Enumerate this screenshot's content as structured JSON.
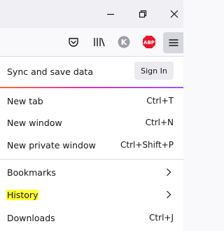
{
  "toolbar": {
    "icons": [
      "pocket-icon",
      "library-icon",
      "k-extension-icon",
      "adblock-plus-icon",
      "hamburger-menu-icon"
    ],
    "k_label": "K",
    "abp_label": "ABP"
  },
  "menu": {
    "sync_label": "Sync and save data",
    "signin_label": "Sign In",
    "items": [
      {
        "label": "New tab",
        "shortcut": "Ctrl+T"
      },
      {
        "label": "New window",
        "shortcut": "Ctrl+N"
      },
      {
        "label": "New private window",
        "shortcut": "Ctrl+Shift+P"
      },
      {
        "label": "Bookmarks",
        "shortcut": ""
      },
      {
        "label": "History",
        "shortcut": ""
      },
      {
        "label": "Downloads",
        "shortcut": "Ctrl+J"
      }
    ]
  },
  "colors": {
    "highlight": "#ffff33",
    "abp_red": "#e3182d",
    "k_gray": "#9e9ea6"
  }
}
